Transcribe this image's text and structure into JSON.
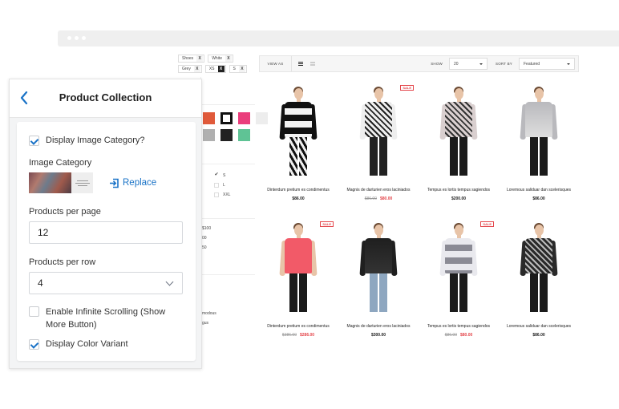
{
  "browser": {
    "dots": 3
  },
  "filter_tags": {
    "rows": [
      [
        {
          "label": "Shoes",
          "x": "X"
        },
        {
          "label": "White",
          "x": "X"
        }
      ],
      [
        {
          "label": "Grey",
          "x": "X"
        },
        {
          "label": "XS",
          "x": "X",
          "active": true
        },
        {
          "label": "S",
          "x": "X"
        }
      ]
    ]
  },
  "filters": {
    "color_swatches": [
      {
        "name": "red",
        "color": "#e05a3a"
      },
      {
        "name": "white",
        "color": "#ffffff",
        "selected": true
      },
      {
        "name": "pink",
        "color": "#ea3e7c"
      },
      {
        "name": "light-grey",
        "color": "#ededed"
      },
      {
        "name": "grey",
        "color": "#b0b0b0"
      },
      {
        "name": "black",
        "color": "#222222"
      },
      {
        "name": "green",
        "color": "#5fc395"
      }
    ],
    "sizes": [
      {
        "label": "S",
        "checked": true
      },
      {
        "label": "L",
        "checked": false
      },
      {
        "label": "XXL",
        "checked": false
      }
    ],
    "prices": [
      "$100",
      "00",
      "50"
    ],
    "misc": [
      "modous",
      "gus"
    ]
  },
  "toolbar": {
    "view_as_label": "VIEW AS",
    "show_label": "SHOW",
    "show_value": "20",
    "sort_label": "SORT BY",
    "sort_value": "Featured"
  },
  "products": [
    {
      "name": "Dinterdum pretium es condimentus",
      "price": "$86.00",
      "old_price": null,
      "sale": false,
      "top": "#111",
      "top2": "#f3f3f3",
      "bottom": "#e8e8e8",
      "style": "stripe"
    },
    {
      "name": "Magnis de darturien eros laciniados",
      "price": "$80.00",
      "old_price": "$86.00",
      "sale": true,
      "top": "#eeeeee",
      "top2": "#222",
      "bottom": "#222",
      "style": "pattern"
    },
    {
      "name": "Tempus es lortis tempus sagiendos",
      "price": "$200.00",
      "old_price": null,
      "sale": false,
      "top": "#d9cfcf",
      "top2": "#333",
      "bottom": "#1b1b1b",
      "style": "pattern"
    },
    {
      "name": "Loremous saliduar dan scelerisques",
      "price": "$86.00",
      "old_price": null,
      "sale": false,
      "top": "#b9b9bd",
      "top2": "#dedede",
      "bottom": "#1b1b1b",
      "style": "plain"
    },
    {
      "name": "Dinterdum pretium es condimentus",
      "price": "$286.00",
      "old_price": "$386.00",
      "sale": true,
      "top": "#f25a68",
      "top2": "#f25a68",
      "bottom": "#1b1b1b",
      "style": "plain"
    },
    {
      "name": "Magnis de darturien eros laciniados",
      "price": "$300.00",
      "old_price": null,
      "sale": false,
      "top": "#1f1f1f",
      "top2": "#333",
      "bottom": "#8ea7c0",
      "style": "plain"
    },
    {
      "name": "Tempus es lortis tempus sagiendos",
      "price": "$80.00",
      "old_price": "$86.00",
      "sale": true,
      "top": "#e9e9ee",
      "top2": "#8b8b95",
      "bottom": "#1b1b1b",
      "style": "stripe"
    },
    {
      "name": "Loremous saliduar dan scelerisques",
      "price": "$86.00",
      "old_price": null,
      "sale": false,
      "top": "#2a2a2a",
      "top2": "#bbbbbb",
      "bottom": "#1b1b1b",
      "style": "pattern"
    }
  ],
  "sale_badge_label": "SALE",
  "panel": {
    "title": "Product Collection",
    "display_image_category": {
      "label": "Display Image Category?",
      "checked": true
    },
    "image_category_label": "Image Category",
    "replace_label": "Replace",
    "products_per_page": {
      "label": "Products per page",
      "value": "12"
    },
    "products_per_row": {
      "label": "Products per row",
      "value": "4"
    },
    "infinite_scrolling": {
      "label": "Enable Infinite Scrolling (Show More Button)",
      "checked": false
    },
    "display_color_variant": {
      "label": "Display Color Variant",
      "checked": true
    }
  },
  "colors": {
    "accent": "#1a73c7",
    "sale": "#e4464b"
  }
}
